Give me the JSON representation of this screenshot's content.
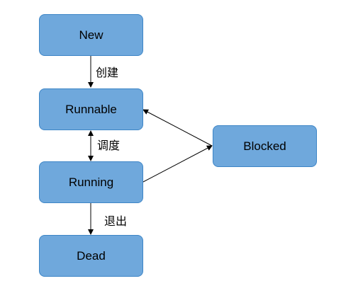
{
  "nodes": {
    "new": "New",
    "runnable": "Runnable",
    "running": "Running",
    "blocked": "Blocked",
    "dead": "Dead"
  },
  "edges": {
    "new_to_runnable": "创建",
    "runnable_running": "调度",
    "running_to_dead": "退出"
  },
  "colors": {
    "node_fill": "#6fa8dc",
    "node_border": "#3d85c6",
    "edge": "#000000"
  }
}
